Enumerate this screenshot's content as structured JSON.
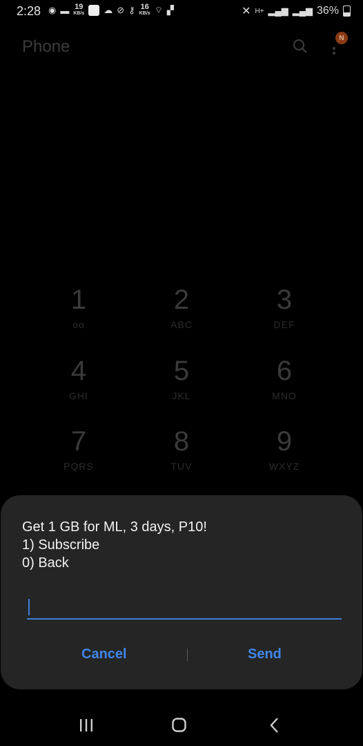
{
  "status_bar": {
    "time": "2:28",
    "speed_1": "19",
    "speed_1_unit": "KB/s",
    "speed_2": "16",
    "speed_2_unit": "KB/s",
    "network": "H+",
    "battery": "36%"
  },
  "app": {
    "title": "Phone",
    "badge": "N",
    "keys": [
      {
        "num": "1",
        "sub": "oo"
      },
      {
        "num": "2",
        "sub": "ABC"
      },
      {
        "num": "3",
        "sub": "DEF"
      },
      {
        "num": "4",
        "sub": "GHI"
      },
      {
        "num": "5",
        "sub": "JKL"
      },
      {
        "num": "6",
        "sub": "MNO"
      },
      {
        "num": "7",
        "sub": "PQRS"
      },
      {
        "num": "8",
        "sub": "TUV"
      },
      {
        "num": "9",
        "sub": "WXYZ"
      }
    ]
  },
  "dialog": {
    "message": "Get 1 GB for ML, 3 days, P10!\n1) Subscribe\n0) Back",
    "input_value": "",
    "cancel_label": "Cancel",
    "send_label": "Send"
  },
  "colors": {
    "accent": "#3f86e6",
    "dialog_bg": "#252525",
    "background": "#000000"
  }
}
